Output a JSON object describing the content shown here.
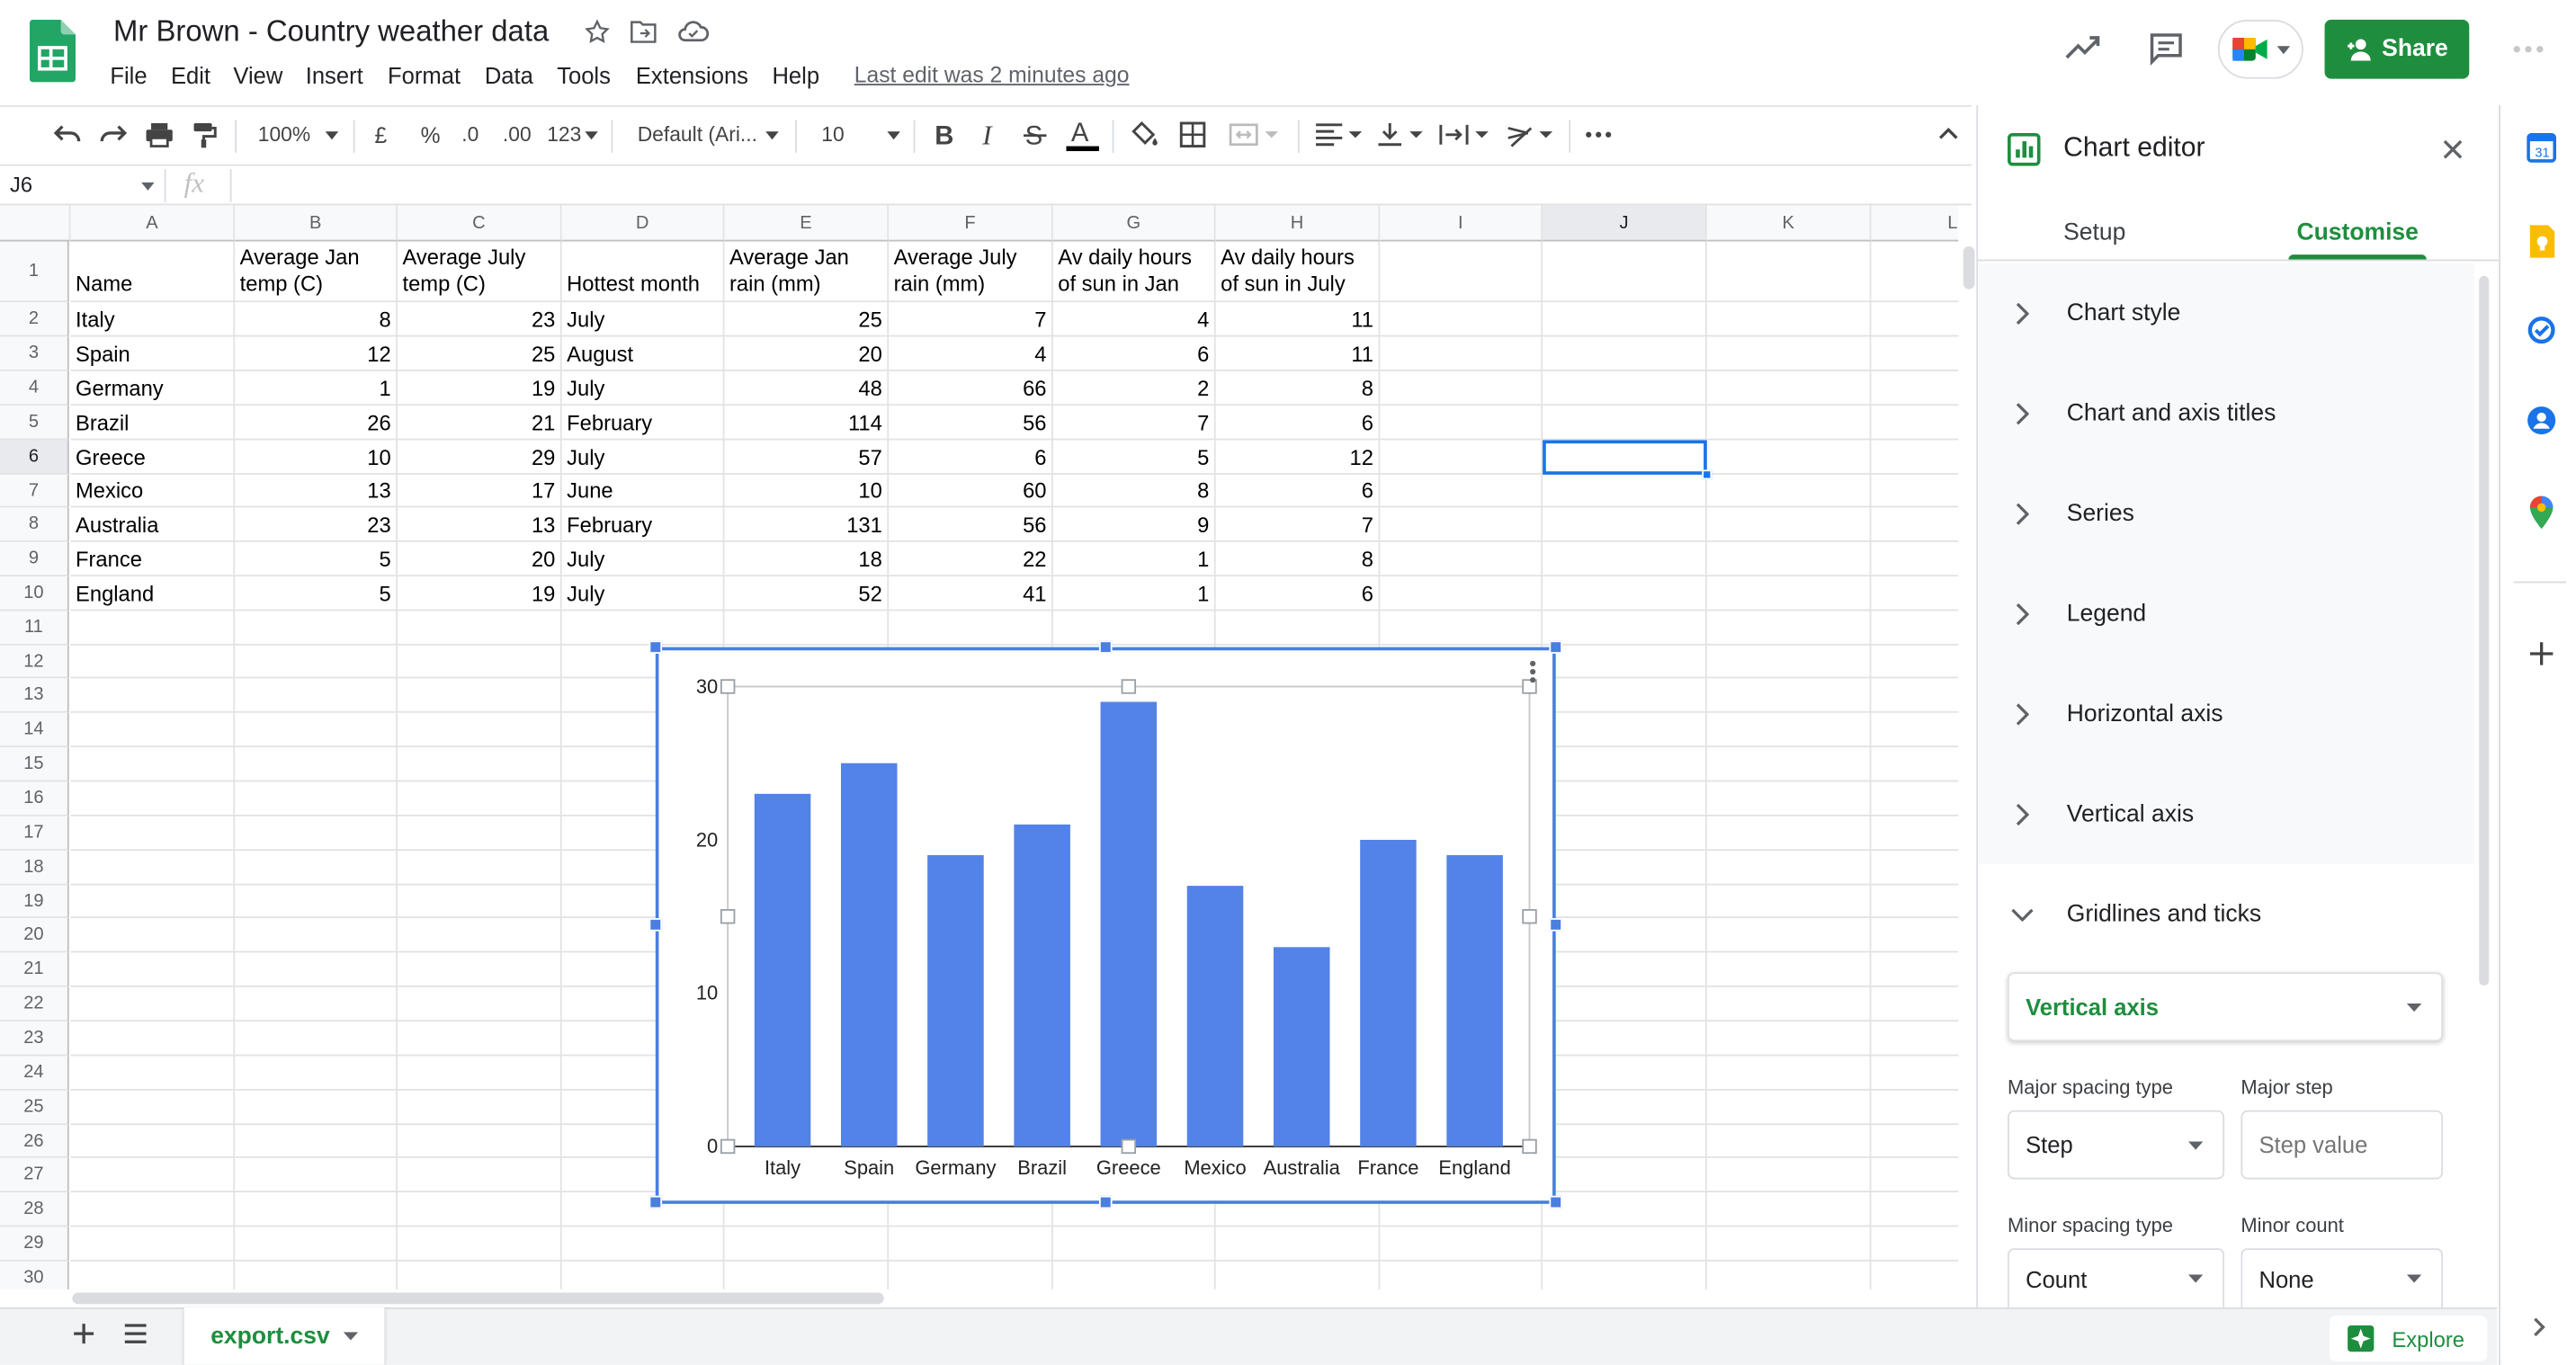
{
  "doc": {
    "title": "Mr Brown - Country weather data",
    "last_edit": "Last edit was 2 minutes ago",
    "share_label": "Share",
    "menu": [
      "File",
      "Edit",
      "View",
      "Insert",
      "Format",
      "Data",
      "Tools",
      "Extensions",
      "Help"
    ]
  },
  "toolbar": {
    "zoom": "100%",
    "currency": "£",
    "percent": "%",
    "decrease_decimal": ".0",
    "increase_decimal": ".00",
    "more_formats": "123",
    "font": "Default (Ari...",
    "font_size": "10"
  },
  "formula_bar": {
    "cell_ref": "J6",
    "fx": "fx"
  },
  "sheet": {
    "columns": [
      "A",
      "B",
      "C",
      "D",
      "E",
      "F",
      "G",
      "H",
      "I",
      "J",
      "K",
      "L"
    ],
    "rows": [
      "1",
      "2",
      "3",
      "4",
      "5",
      "6",
      "7",
      "8",
      "9",
      "10",
      "11",
      "12",
      "13",
      "14",
      "15",
      "16",
      "17",
      "18",
      "19",
      "20",
      "21",
      "22",
      "23",
      "24",
      "25",
      "26",
      "27",
      "28",
      "29",
      "30"
    ],
    "header": [
      "Name",
      "Average Jan temp (C)",
      "Average July temp (C)",
      "Hottest month",
      "Average Jan rain (mm)",
      "Average July rain (mm)",
      "Av daily hours of sun in Jan",
      "Av daily hours of sun in July"
    ],
    "data": [
      [
        "Italy",
        "8",
        "23",
        "July",
        "25",
        "7",
        "4",
        "11"
      ],
      [
        "Spain",
        "12",
        "25",
        "August",
        "20",
        "4",
        "6",
        "11"
      ],
      [
        "Germany",
        "1",
        "19",
        "July",
        "48",
        "66",
        "2",
        "8"
      ],
      [
        "Brazil",
        "26",
        "21",
        "February",
        "114",
        "56",
        "7",
        "6"
      ],
      [
        "Greece",
        "10",
        "29",
        "July",
        "57",
        "6",
        "5",
        "12"
      ],
      [
        "Mexico",
        "13",
        "17",
        "June",
        "10",
        "60",
        "8",
        "6"
      ],
      [
        "Australia",
        "23",
        "13",
        "February",
        "131",
        "56",
        "9",
        "7"
      ],
      [
        "France",
        "5",
        "20",
        "July",
        "18",
        "22",
        "1",
        "8"
      ],
      [
        "England",
        "5",
        "19",
        "July",
        "52",
        "41",
        "1",
        "6"
      ]
    ],
    "selected_cell": "J6"
  },
  "chart_data": {
    "type": "bar",
    "categories": [
      "Italy",
      "Spain",
      "Germany",
      "Brazil",
      "Greece",
      "Mexico",
      "Australia",
      "France",
      "England"
    ],
    "values": [
      23,
      25,
      19,
      21,
      29,
      17,
      13,
      20,
      19
    ],
    "title": "",
    "xlabel": "",
    "ylabel": "",
    "ylim": [
      0,
      30
    ],
    "yticks": [
      "0",
      "10",
      "20",
      "30"
    ],
    "color": "#5382e8",
    "grid": false,
    "legend": "none"
  },
  "sheet_tab": {
    "name": "export.csv"
  },
  "explore_label": "Explore",
  "chart_editor": {
    "title": "Chart editor",
    "tabs": [
      "Setup",
      "Customise"
    ],
    "active_tab": "Customise",
    "sections": [
      "Chart style",
      "Chart and axis titles",
      "Series",
      "Legend",
      "Horizontal axis",
      "Vertical axis",
      "Gridlines and ticks"
    ],
    "expanded_section": "Gridlines and ticks",
    "axis_select": "Vertical axis",
    "major_spacing_type_label": "Major spacing type",
    "major_spacing_type_value": "Step",
    "major_step_label": "Major step",
    "major_step_placeholder": "Step value",
    "minor_spacing_type_label": "Minor spacing type",
    "minor_spacing_type_value": "Count",
    "minor_count_label": "Minor count",
    "minor_count_value": "None"
  },
  "colors": {
    "accent": "#1e8e3e",
    "selection": "#1a73e8",
    "bar": "#5382e8"
  }
}
